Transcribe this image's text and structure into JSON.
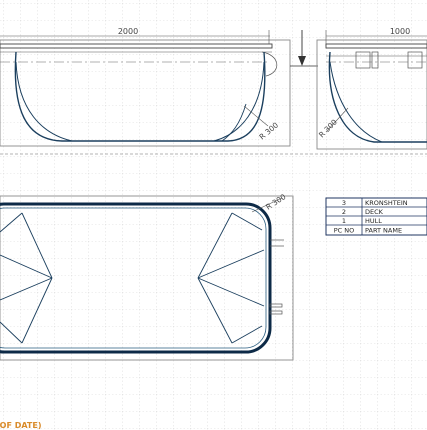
{
  "drawing": {
    "dimensions": {
      "side_length": "2000",
      "end_width": "1000",
      "side_radius": "R 300",
      "end_radius": "R 300",
      "plan_radius": "R 300"
    },
    "parts_table": {
      "header": {
        "no": "PC NO",
        "name": "PART NAME"
      },
      "rows": [
        {
          "no": "3",
          "name": "KRONSHTEIN"
        },
        {
          "no": "2",
          "name": "DECK"
        },
        {
          "no": "1",
          "name": "HULL"
        }
      ]
    },
    "stamp": "(OF DATE)"
  },
  "colors": {
    "hull_line": "#1b3f5e",
    "hull_line_bold": "#0d2a47",
    "outline": "#7a7a7a",
    "grid": "#bdbdbd",
    "table_border": "#1f3560",
    "stamp": "#d98b2a"
  }
}
